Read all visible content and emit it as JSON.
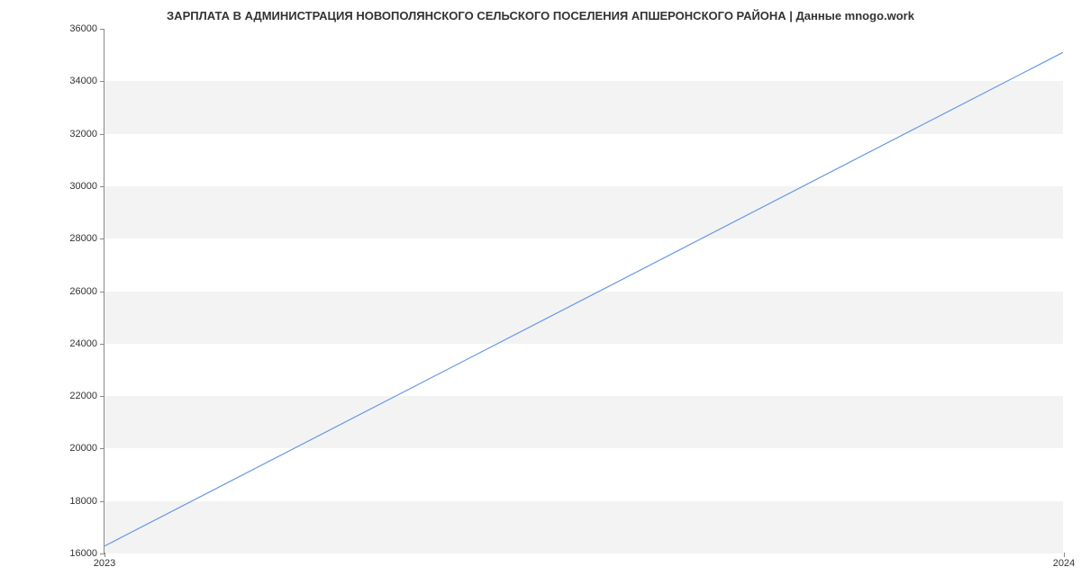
{
  "chart_data": {
    "type": "line",
    "title": "ЗАРПЛАТА В АДМИНИСТРАЦИЯ НОВОПОЛЯНСКОГО СЕЛЬСКОГО ПОСЕЛЕНИЯ АПШЕРОНСКОГО РАЙОНА | Данные mnogo.work",
    "x": [
      2023,
      2024
    ],
    "values": [
      16250,
      35100
    ],
    "xlabel": "",
    "ylabel": "",
    "xlim": [
      2023,
      2024
    ],
    "ylim": [
      16000,
      36000
    ],
    "x_ticks": [
      "2023",
      "2024"
    ],
    "y_ticks": [
      "16000",
      "18000",
      "20000",
      "22000",
      "24000",
      "26000",
      "28000",
      "30000",
      "32000",
      "34000",
      "36000"
    ],
    "line_color": "#6699e6",
    "band_color": "#f3f3f3"
  }
}
